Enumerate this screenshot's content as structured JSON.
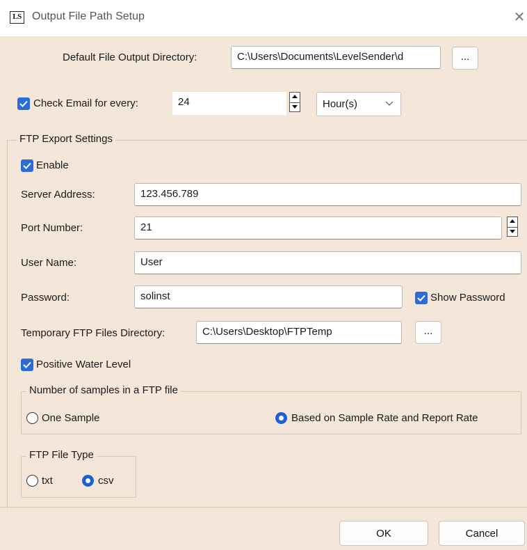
{
  "window": {
    "app_icon_text": "LS",
    "title": "Output File Path Setup",
    "close_symbol": "✕"
  },
  "output_dir": {
    "label": "Default File Output Directory:",
    "value": "C:\\Users\\Documents\\LevelSender\\d",
    "browse_label": "..."
  },
  "email": {
    "checked": true,
    "label": "Check Email for every:",
    "value": "24",
    "unit": "Hour(s)"
  },
  "ftp": {
    "group_title": "FTP Export Settings",
    "enable_label": "Enable",
    "server_label": "Server Address:",
    "server_value": "123.456.789",
    "port_label": "Port Number:",
    "port_value": "21",
    "user_label": "User Name:",
    "user_value": "User",
    "password_label": "Password:",
    "password_value": "solinst",
    "show_password_label": "Show Password",
    "temp_dir_label": "Temporary FTP Files Directory:",
    "temp_dir_value": "C:\\Users\\Desktop\\FTPTemp",
    "temp_browse_label": "...",
    "positive_level_label": "Positive Water Level"
  },
  "samples": {
    "group_title": "Number of samples in a FTP file",
    "one_sample_label": "One Sample",
    "based_label": "Based on Sample Rate and Report Rate",
    "selected": "based"
  },
  "file_type": {
    "group_title": "FTP File Type",
    "txt_label": "txt",
    "csv_label": "csv",
    "selected": "csv"
  },
  "buttons": {
    "ok_label": "OK",
    "cancel_label": "Cancel"
  },
  "colors": {
    "accent": "#2d6bd6",
    "dialog_bg": "#f4e6d8"
  },
  "icons": {
    "app": "ls-app-icon",
    "close": "close-icon",
    "checkbox": "checkmark-icon",
    "dropdown": "chevron-down-icon"
  }
}
